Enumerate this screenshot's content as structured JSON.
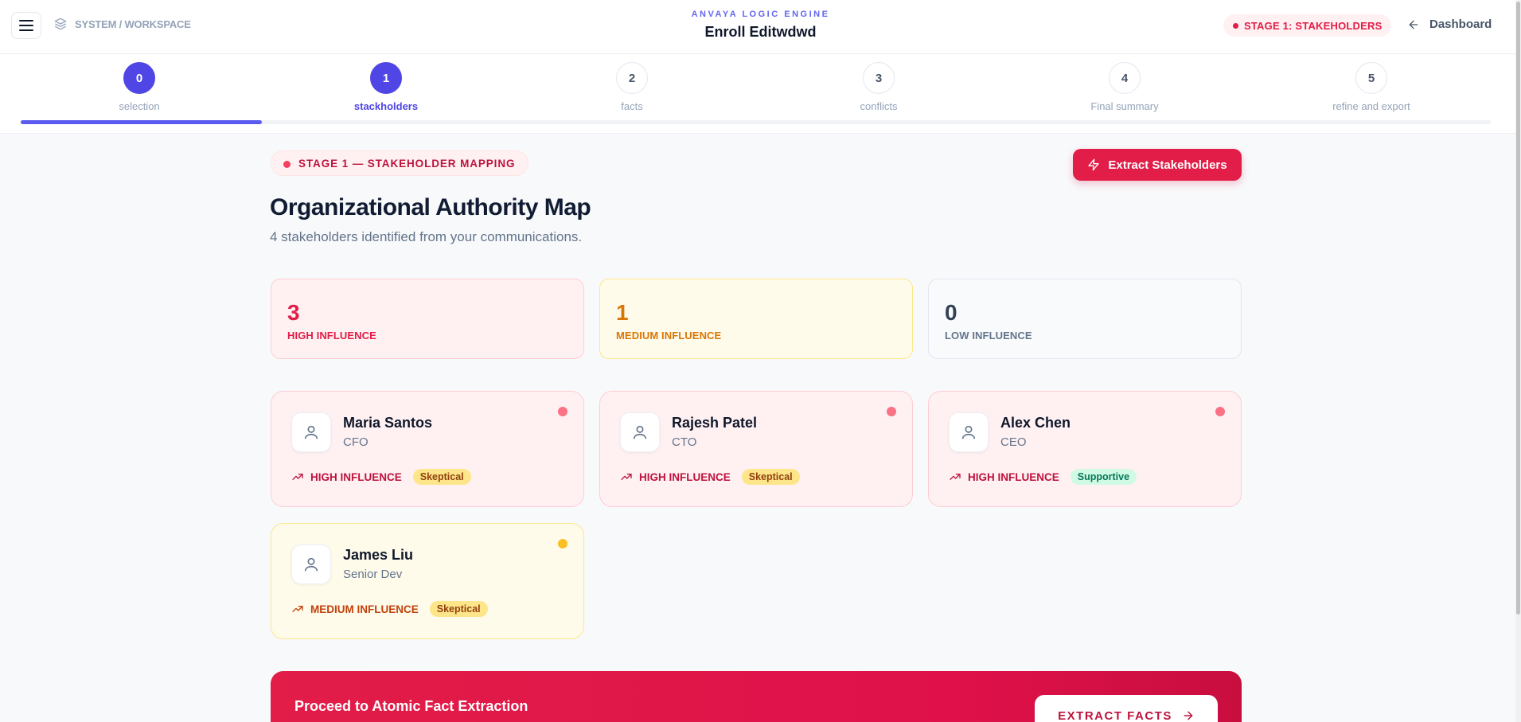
{
  "header": {
    "breadcrumb": "SYSTEM / WORKSPACE",
    "brand_subtitle": "ANVAYA LOGIC ENGINE",
    "project_title": "Enroll Editwdwd",
    "stage_pill": "STAGE 1: STAKEHOLDERS",
    "dashboard_label": "Dashboard"
  },
  "stepper": {
    "steps": [
      {
        "number": "0",
        "label": "selection",
        "state": "done"
      },
      {
        "number": "1",
        "label": "stackholders",
        "state": "active"
      },
      {
        "number": "2",
        "label": "facts",
        "state": "pending"
      },
      {
        "number": "3",
        "label": "conflicts",
        "state": "pending"
      },
      {
        "number": "4",
        "label": "Final summary",
        "state": "pending"
      },
      {
        "number": "5",
        "label": "refine and export",
        "state": "pending"
      }
    ],
    "progress_fraction": 0.164
  },
  "main": {
    "stage_badge": "STAGE 1 — STAKEHOLDER MAPPING",
    "extract_button": "Extract Stakeholders",
    "title": "Organizational Authority Map",
    "subtitle": "4 stakeholders identified from your communications."
  },
  "stats": [
    {
      "value": "3",
      "label": "HIGH INFLUENCE",
      "level": "high"
    },
    {
      "value": "1",
      "label": "MEDIUM INFLUENCE",
      "level": "medium"
    },
    {
      "value": "0",
      "label": "LOW INFLUENCE",
      "level": "low"
    }
  ],
  "stakeholders": [
    {
      "name": "Maria Santos",
      "role": "CFO",
      "influence": "HIGH INFLUENCE",
      "stance": "Skeptical"
    },
    {
      "name": "Rajesh Patel",
      "role": "CTO",
      "influence": "HIGH INFLUENCE",
      "stance": "Skeptical"
    },
    {
      "name": "Alex Chen",
      "role": "CEO",
      "influence": "HIGH INFLUENCE",
      "stance": "Supportive"
    },
    {
      "name": "James Liu",
      "role": "Senior Dev",
      "influence": "MEDIUM INFLUENCE",
      "stance": "Skeptical"
    }
  ],
  "banner": {
    "title": "Proceed to Atomic Fact Extraction",
    "button": "EXTRACT FACTS"
  },
  "colors": {
    "accent": "#4f46e5",
    "brand_red": "#e11d48",
    "medium": "#d97706"
  }
}
